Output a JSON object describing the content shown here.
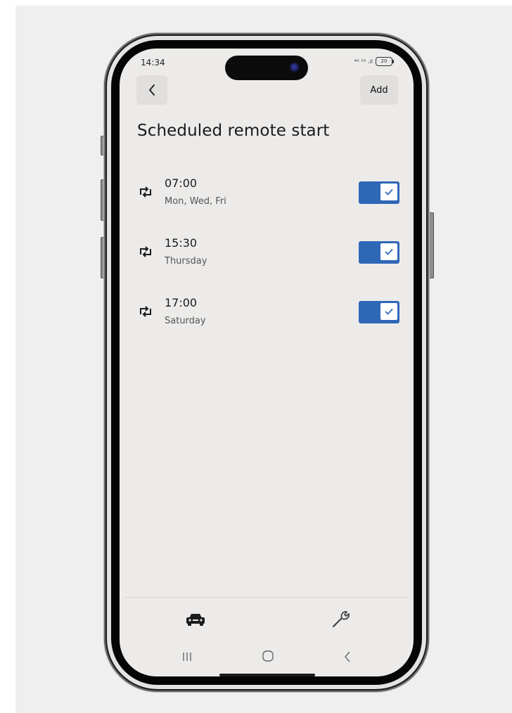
{
  "status_bar": {
    "time": "14:34",
    "signal_text": "⁴ᴳ ⁵ᴳ .ıl",
    "battery_level": "20"
  },
  "header": {
    "back_icon": "chevron-left-icon",
    "add_label": "Add",
    "title": "Scheduled remote start"
  },
  "schedules": [
    {
      "time": "07:00",
      "days": "Mon, Wed, Fri",
      "enabled": true
    },
    {
      "time": "15:30",
      "days": "Thursday",
      "enabled": true
    },
    {
      "time": "17:00",
      "days": "Saturday",
      "enabled": true
    }
  ],
  "bottom_tabs": [
    {
      "icon": "car-icon"
    },
    {
      "icon": "wrench-icon"
    }
  ],
  "system_nav": [
    "recents-icon",
    "home-icon",
    "back-icon"
  ],
  "colors": {
    "toggle_on": "#2f67b7",
    "screen_bg": "#ecebea",
    "button_bg": "#e0dfde"
  }
}
